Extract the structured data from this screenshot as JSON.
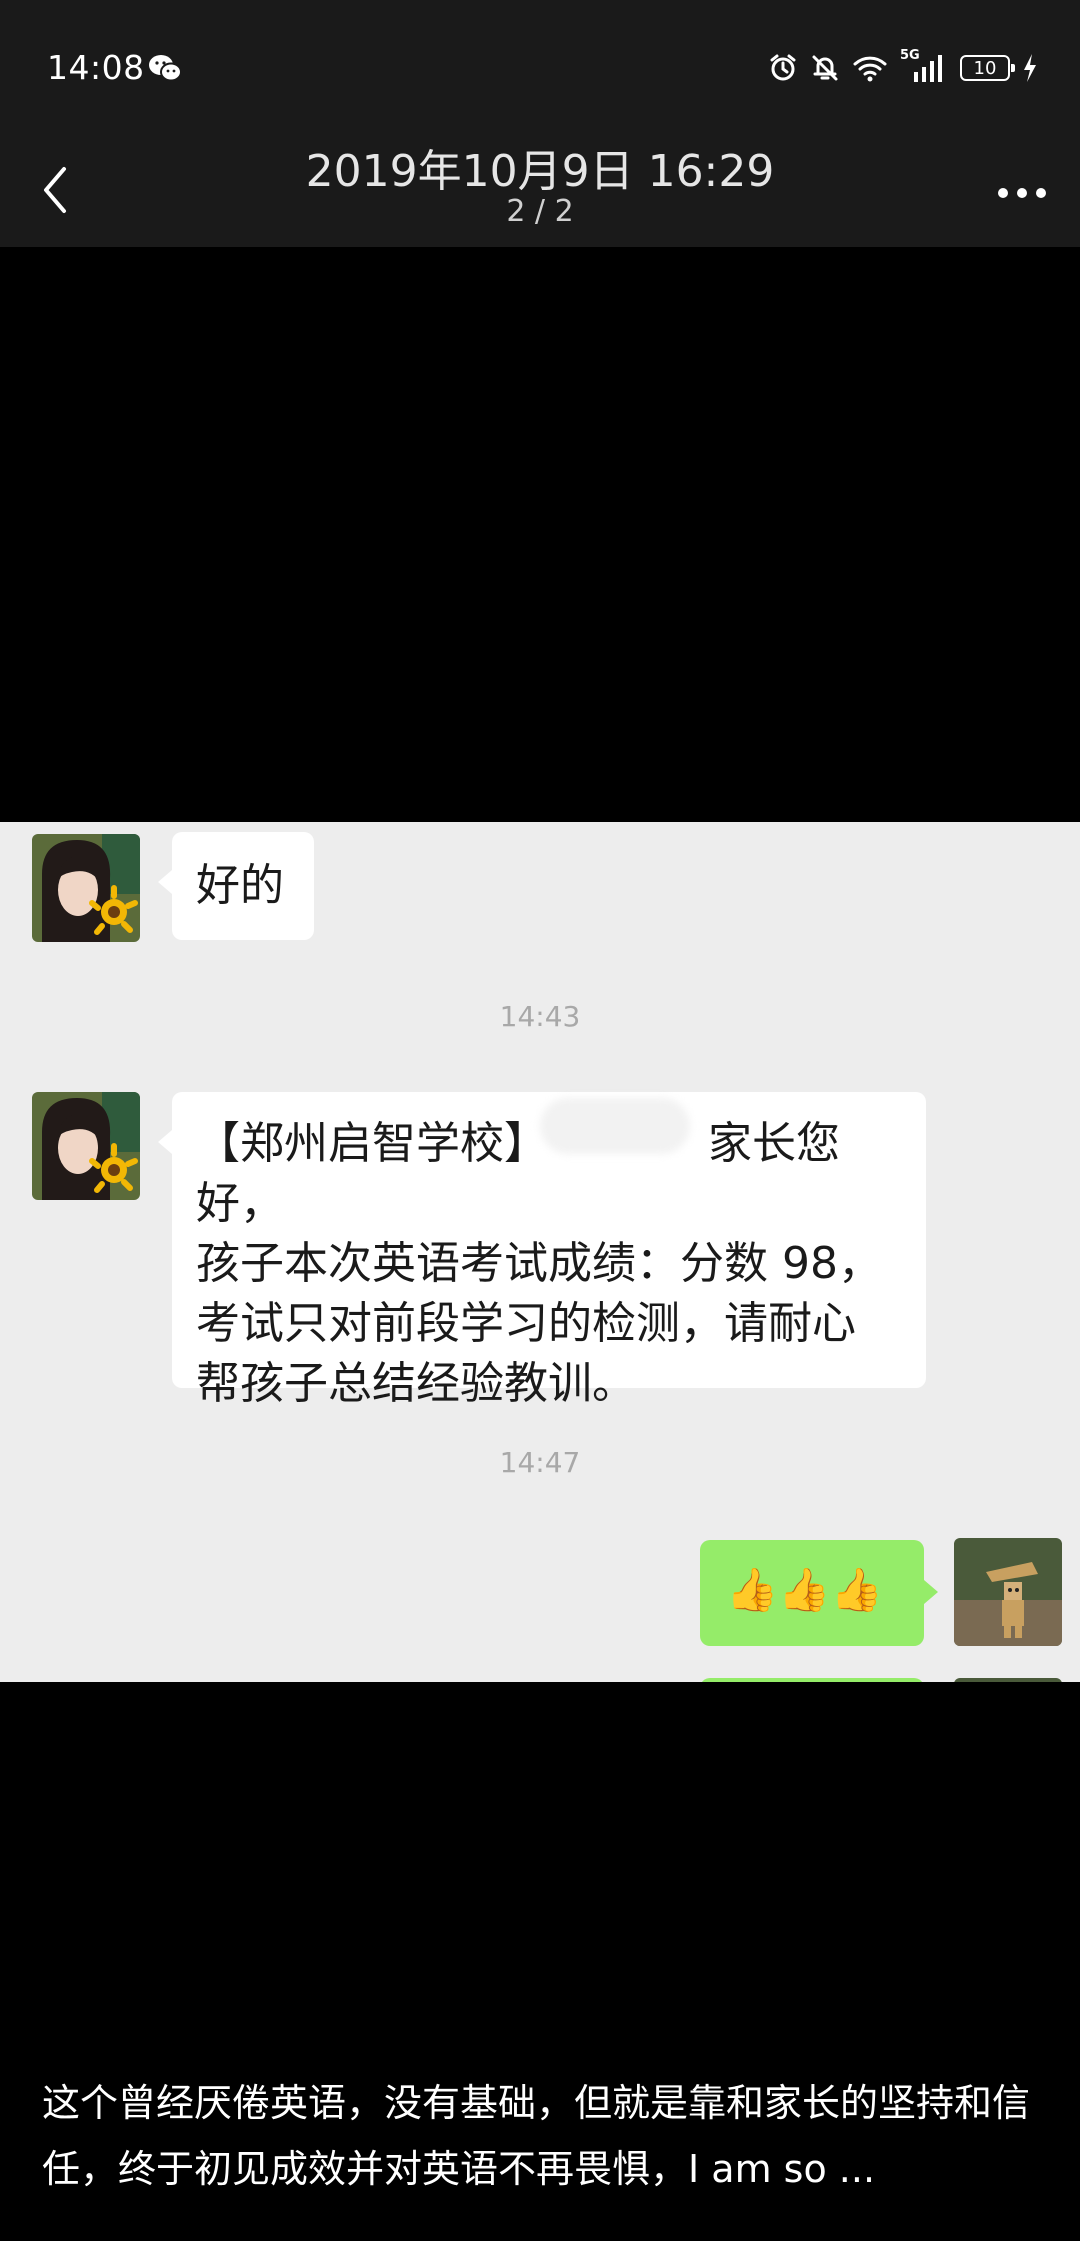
{
  "status_bar": {
    "time": "14:08",
    "left_icon": "wechat-icon",
    "right_icons": [
      "alarm-icon",
      "mute-bell-icon",
      "wifi-icon",
      "5g-signal-icon"
    ],
    "signal_label": "5G",
    "battery_level": "10",
    "charging_icon": "bolt-icon"
  },
  "header": {
    "title": "2019年10月9日 16:29",
    "counter": "2 / 2",
    "back_icon": "chevron-left-icon",
    "more_icon": "more-horizontal-icon"
  },
  "photo": {
    "messages": [
      {
        "side": "left",
        "text": "好的"
      },
      {
        "timestamp": "14:43"
      },
      {
        "side": "left",
        "lines": [
          "【郑州启智学校】",
          "家长您好，",
          "孩子本次英语考试成绩：分数 98，",
          "考试只对前段学习的检测，请耐心",
          "帮孩子总结经验教训。"
        ]
      },
      {
        "timestamp": "14:47"
      },
      {
        "side": "right",
        "text": "👍👍👍"
      }
    ]
  },
  "caption": {
    "text": "这个曾经厌倦英语，没有基础，但就是靠和家长的坚持和信任，终于初见成效并对英语不再畏惧，I am so ..."
  },
  "colors": {
    "bar_bg": "#1a1a1a",
    "viewer_bg": "#000000",
    "chat_bg": "#ededed",
    "green_bubble": "#95ec69"
  }
}
